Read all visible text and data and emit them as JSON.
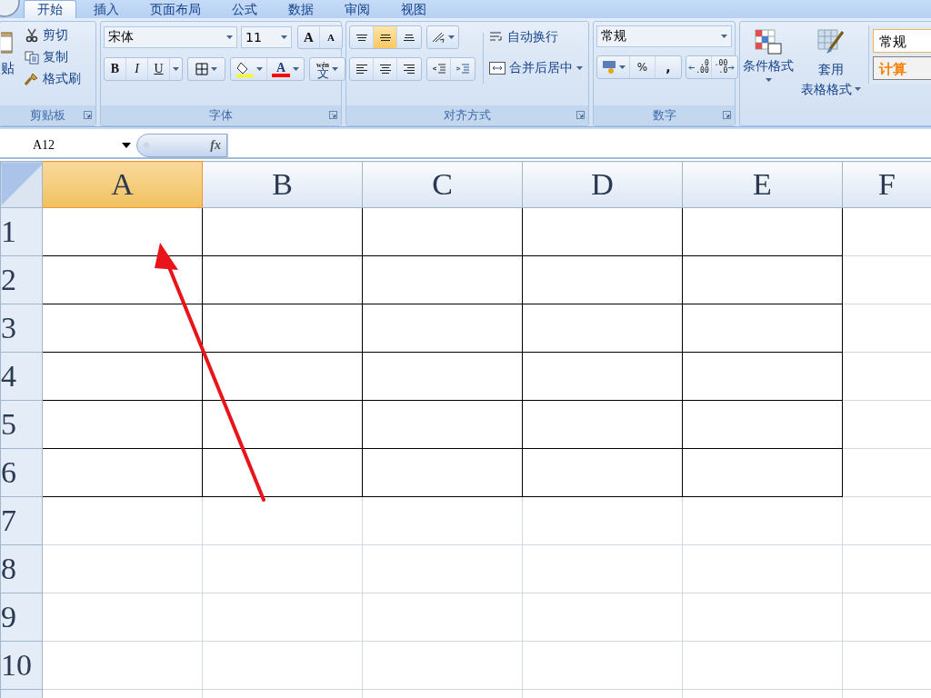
{
  "tabs": [
    {
      "label": "开始",
      "selected": true
    },
    {
      "label": "插入",
      "selected": false
    },
    {
      "label": "页面布局",
      "selected": false
    },
    {
      "label": "公式",
      "selected": false
    },
    {
      "label": "数据",
      "selected": false
    },
    {
      "label": "审阅",
      "selected": false
    },
    {
      "label": "视图",
      "selected": false
    }
  ],
  "ribbon": {
    "clipboard": {
      "paste_label": "贴",
      "items": [
        {
          "kind": "cut",
          "label": "剪切"
        },
        {
          "kind": "copy",
          "label": "复制"
        },
        {
          "kind": "painter",
          "label": "格式刷"
        }
      ],
      "title": "剪贴板"
    },
    "font": {
      "font_name": "宋体",
      "font_size": "11",
      "size_buttons": [
        {
          "kind": "grow",
          "label": "A"
        },
        {
          "kind": "shrink",
          "label": "A"
        }
      ],
      "style_buttons": [
        {
          "kind": "bold",
          "label": "B"
        },
        {
          "kind": "italic",
          "label": "I"
        },
        {
          "kind": "underline",
          "label": "U"
        }
      ],
      "font_color_label": "A",
      "phonetic_label": "文",
      "phonetic_ruby": "wén",
      "title": "字体"
    },
    "alignment": {
      "vertical": [
        {
          "kind": "top",
          "selected": false
        },
        {
          "kind": "middle",
          "selected": true
        },
        {
          "kind": "bottom",
          "selected": false
        }
      ],
      "horizontal": [
        {
          "kind": "left",
          "selected": false
        },
        {
          "kind": "center",
          "selected": false
        },
        {
          "kind": "right",
          "selected": false
        }
      ],
      "wrap_label": "自动换行",
      "merge_label": "合并后居中",
      "title": "对齐方式"
    },
    "number": {
      "format": "常规",
      "buttons": [
        {
          "kind": "percent",
          "label": "%"
        },
        {
          "kind": "comma",
          "label": ","
        }
      ],
      "decimal_buttons": [
        {
          "kind": "increase",
          "top": ".0",
          "bottom": ".00"
        },
        {
          "kind": "decrease",
          "top": ".00",
          "bottom": ".0"
        }
      ],
      "title": "数字"
    },
    "styles": {
      "conditional_label": "条件格式",
      "table_format_lines": [
        "套用",
        "表格格式"
      ],
      "cell_styles": [
        {
          "kind": "normal",
          "label": "常规"
        },
        {
          "kind": "calculation",
          "label": "计算"
        }
      ]
    }
  },
  "formula_bar": {
    "name_box": "A12",
    "fx_label": "fx"
  },
  "sheet": {
    "columns": [
      {
        "label": "A",
        "selected": true
      },
      {
        "label": "B",
        "selected": false
      },
      {
        "label": "C",
        "selected": false
      },
      {
        "label": "D",
        "selected": false
      },
      {
        "label": "E",
        "selected": false
      },
      {
        "label": "F",
        "selected": false
      }
    ],
    "rows": [
      {
        "label": "1",
        "bordered": true
      },
      {
        "label": "2",
        "bordered": true
      },
      {
        "label": "3",
        "bordered": true
      },
      {
        "label": "4",
        "bordered": true
      },
      {
        "label": "5",
        "bordered": true
      },
      {
        "label": "6",
        "bordered": true
      },
      {
        "label": "7",
        "bordered": false
      },
      {
        "label": "8",
        "bordered": false
      },
      {
        "label": "9",
        "bordered": false
      },
      {
        "label": "10",
        "bordered": false
      }
    ]
  }
}
